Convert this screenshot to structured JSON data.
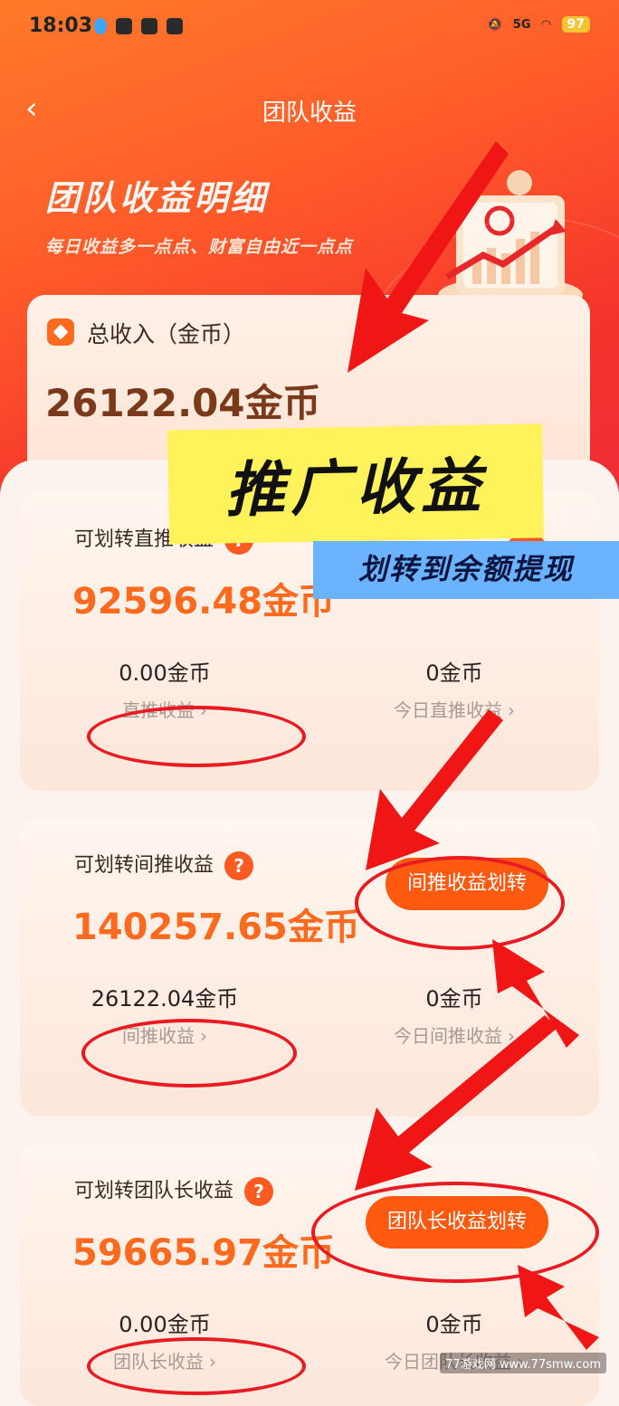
{
  "status_bar": {
    "time": "18:03",
    "network": "5G",
    "battery": "97"
  },
  "nav": {
    "title": "团队收益"
  },
  "banner": {
    "title": "团队收益明细",
    "subtitle": "每日收益多一点点、财富自由近一点点"
  },
  "total": {
    "label": "总收入（金币）",
    "value": "26122.04金币"
  },
  "cards": [
    {
      "title": "可划转直推收益",
      "value": "92596.48金币",
      "button": "",
      "left_value": "0.00金币",
      "left_link": "直推收益",
      "right_value": "0金币",
      "right_link": "今日直推收益"
    },
    {
      "title": "可划转间推收益",
      "value": "140257.65金币",
      "button": "间推收益划转",
      "left_value": "26122.04金币",
      "left_link": "间推收益",
      "right_value": "0金币",
      "right_link": "今日间推收益"
    },
    {
      "title": "可划转团队长收益",
      "value": "59665.97金币",
      "button": "团队长收益划转",
      "left_value": "0.00金币",
      "left_link": "团队长收益",
      "right_value": "0金币",
      "right_link": "今日团队长收益"
    }
  ],
  "overlay": {
    "headline": "推广收益",
    "subline": "划转到余额提现"
  },
  "watermark": "77游戏网 www.77smw.com",
  "colors": {
    "accent": "#ff5a10",
    "annotation": "#e81a22",
    "value_orange": "#ff6a1f"
  }
}
